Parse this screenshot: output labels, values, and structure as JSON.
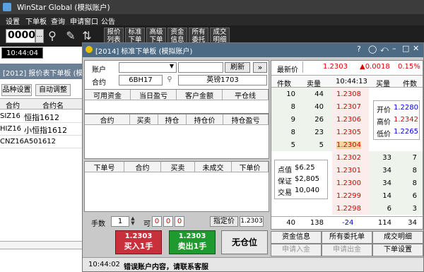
{
  "app": {
    "title": "WinStar Global (模拟账户)"
  },
  "menu": [
    "设置",
    "下单板",
    "查询",
    "申请窗口",
    "公告"
  ],
  "toolbar": {
    "contract_code": "0000",
    "dots": "...",
    "buttons": [
      {
        "line1": "报价",
        "line2": "列表"
      },
      {
        "line1": "标准",
        "line2": "下单"
      },
      {
        "line1": "高级",
        "line2": "下单"
      },
      {
        "line1": "资金",
        "line2": "信息"
      },
      {
        "line1": "所有",
        "line2": "委托"
      },
      {
        "line1": "成交",
        "line2": "明细"
      }
    ]
  },
  "clock": "10:44:04",
  "quote_window": {
    "title": "[2012] 报价表下单板 (模拟账户)",
    "btn_variety": "品种设置",
    "btn_auto": "自动调整",
    "col_code": "合约",
    "col_name": "合约名",
    "rows": [
      {
        "code": "SIZ16",
        "name": "恒指1612"
      },
      {
        "code": "HIZ16",
        "name": "小恒指1612"
      },
      {
        "code": "CNZ16",
        "name": "A501612"
      }
    ]
  },
  "order_window": {
    "title": "[2014] 标准下单板 (模拟账户)",
    "account_label": "账户",
    "refresh": "刷新",
    "contract_label": "合约",
    "contract_code": "6BH17",
    "contract_name": "英镑1703",
    "funds_headers": [
      "可用资金",
      "当日盈亏",
      "客户金额",
      "平仓线"
    ],
    "pos_headers": [
      "合约",
      "买卖",
      "持仓",
      "持仓价",
      "持仓盈亏"
    ],
    "order_headers": [
      "下单号",
      "合约",
      "买卖",
      "未成交",
      "下单价"
    ],
    "qty_label": "手数",
    "qty_value": "1",
    "can_label": "可",
    "can_values": [
      "0",
      "0",
      "0"
    ],
    "price_label": "指定价",
    "price_value": "1.2303",
    "buy": {
      "price": "1.2303",
      "label": "买入1手"
    },
    "sell": {
      "price": "1.2303",
      "label": "卖出1手"
    },
    "flat": "无仓位",
    "bottom_buttons": [
      "资金信息",
      "所有委托单",
      "成交明细",
      "申请入金",
      "申请出金",
      "下单设置"
    ],
    "status_time": "10:44:02",
    "status_msg": "错误账户内容，请联系客服"
  },
  "quote": {
    "last_label": "最新价",
    "last": "1.2303",
    "change": "▲0.0018",
    "change_pct": "0.15%",
    "headers": [
      "件数",
      "卖量",
      "10:44:13",
      "买量",
      "件数"
    ],
    "asks": [
      {
        "count": "10",
        "vol": "44",
        "price": "1.2308"
      },
      {
        "count": "8",
        "vol": "40",
        "price": "1.2307"
      },
      {
        "count": "9",
        "vol": "26",
        "price": "1.2306"
      },
      {
        "count": "8",
        "vol": "23",
        "price": "1.2305"
      },
      {
        "count": "5",
        "vol": "5",
        "price": "1.2304"
      }
    ],
    "bids": [
      {
        "price": "1.2302",
        "vol": "33",
        "count": "7"
      },
      {
        "price": "1.2301",
        "vol": "34",
        "count": "8"
      },
      {
        "price": "1.2300",
        "vol": "34",
        "count": "8"
      },
      {
        "price": "1.2299",
        "vol": "14",
        "count": "6"
      },
      {
        "price": "1.2298",
        "vol": "6",
        "count": "3"
      }
    ],
    "open_label": "开价",
    "open": "1.2280",
    "high_label": "高价",
    "high": "1.2342",
    "low_label": "低价",
    "low": "1.2265",
    "tick_label": "点值",
    "tick": "$6.25",
    "margin_label": "保证",
    "margin": "$2,805",
    "trade_label": "交易",
    "trade": "10,040",
    "total_ask_count": "40",
    "total_ask_vol": "138",
    "net": "-24",
    "total_bid_vol": "114",
    "total_bid_count": "34"
  }
}
